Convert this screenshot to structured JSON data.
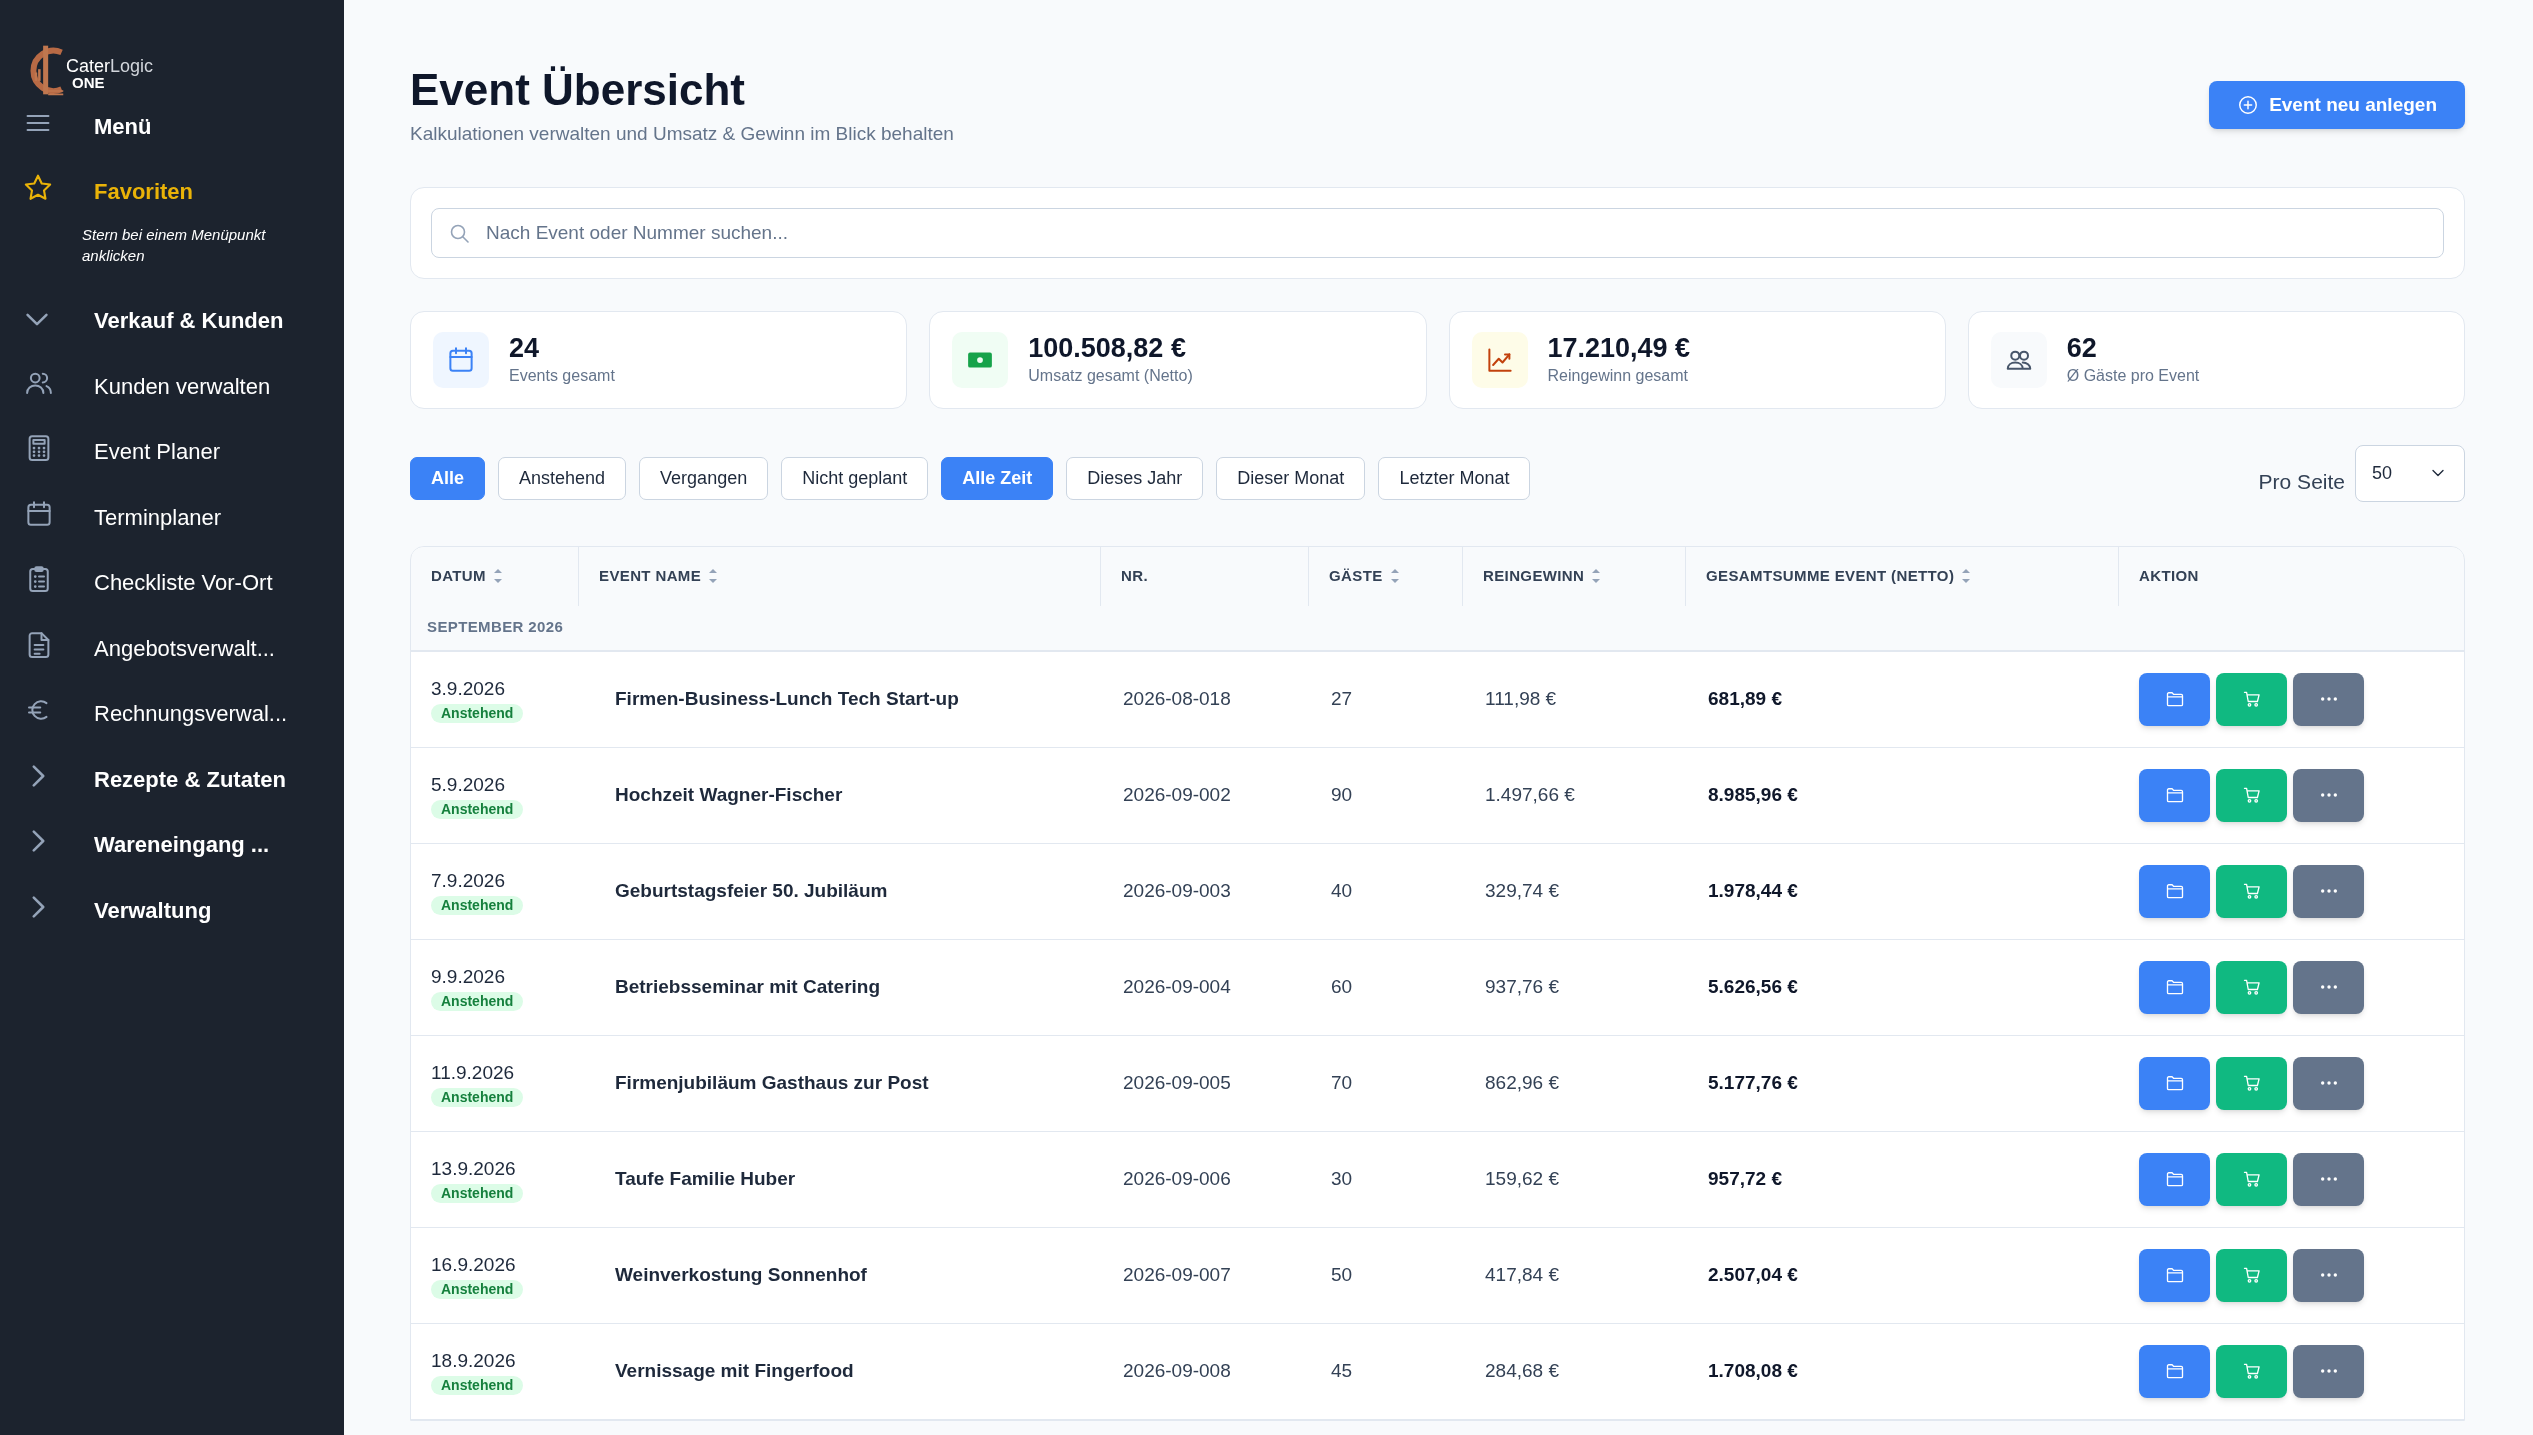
{
  "logo": {
    "part1": "Cater",
    "part2": "Logic",
    "sub": "ONE"
  },
  "sidebar": {
    "items": [
      {
        "kind": "menu",
        "label": "Menü"
      },
      {
        "kind": "favorites",
        "label": "Favoriten"
      },
      {
        "kind": "hint",
        "label": "Stern bei einem Menüpunkt anklicken"
      },
      {
        "kind": "group",
        "label": "Verkauf & Kunden",
        "expanded": true
      },
      {
        "kind": "link",
        "label": "Kunden verwalten"
      },
      {
        "kind": "link",
        "label": "Event Planer"
      },
      {
        "kind": "link",
        "label": "Terminplaner"
      },
      {
        "kind": "link",
        "label": "Checkliste Vor-Ort"
      },
      {
        "kind": "link",
        "label": "Angebotsverwalt..."
      },
      {
        "kind": "link",
        "label": "Rechnungsverwal..."
      },
      {
        "kind": "group",
        "label": "Rezepte & Zutaten",
        "expanded": false
      },
      {
        "kind": "group",
        "label": "Wareneingang ...",
        "expanded": false
      },
      {
        "kind": "group",
        "label": "Verwaltung",
        "expanded": false
      }
    ]
  },
  "header": {
    "title": "Event Übersicht",
    "subtitle": "Kalkulationen verwalten und Umsatz & Gewinn im Blick behalten",
    "new_button": "Event neu anlegen"
  },
  "search": {
    "placeholder": "Nach Event oder Nummer suchen..."
  },
  "stats": [
    {
      "kind": "calendar",
      "value": "24",
      "label": "Events gesamt"
    },
    {
      "kind": "money",
      "value": "100.508,82 €",
      "label": "Umsatz gesamt (Netto)"
    },
    {
      "kind": "chart",
      "value": "17.210,49 €",
      "label": "Reingewinn gesamt"
    },
    {
      "kind": "guests",
      "value": "62",
      "label": "Ø Gäste pro Event"
    }
  ],
  "status_filters": [
    {
      "label": "Alle",
      "selected": true
    },
    {
      "label": "Anstehend",
      "selected": false
    },
    {
      "label": "Vergangen",
      "selected": false
    },
    {
      "label": "Nicht geplant",
      "selected": false
    }
  ],
  "time_filters": [
    {
      "label": "Alle Zeit",
      "selected": true
    },
    {
      "label": "Dieses Jahr",
      "selected": false
    },
    {
      "label": "Dieser Monat",
      "selected": false
    },
    {
      "label": "Letzter Monat",
      "selected": false
    }
  ],
  "per_page": {
    "label": "Pro Seite",
    "value": "50"
  },
  "table": {
    "columns": [
      {
        "label": "DATUM",
        "sortable": true
      },
      {
        "label": "EVENT NAME",
        "sortable": true
      },
      {
        "label": "NR.",
        "sortable": false
      },
      {
        "label": "GÄSTE",
        "sortable": true
      },
      {
        "label": "REINGEWINN",
        "sortable": true
      },
      {
        "label": "GESAMTSUMME EVENT (NETTO)",
        "sortable": true
      },
      {
        "label": "AKTION",
        "sortable": false
      }
    ],
    "group": "SEPTEMBER 2026",
    "rows": [
      {
        "date": "3.9.2026",
        "status": "Anstehend",
        "name": "Firmen-Business-Lunch Tech Start-up",
        "nr": "2026-08-018",
        "guests": "27",
        "profit": "111,98 €",
        "total": "681,89 €"
      },
      {
        "date": "5.9.2026",
        "status": "Anstehend",
        "name": "Hochzeit Wagner-Fischer",
        "nr": "2026-09-002",
        "guests": "90",
        "profit": "1.497,66 €",
        "total": "8.985,96 €"
      },
      {
        "date": "7.9.2026",
        "status": "Anstehend",
        "name": "Geburtstagsfeier 50. Jubiläum",
        "nr": "2026-09-003",
        "guests": "40",
        "profit": "329,74 €",
        "total": "1.978,44 €"
      },
      {
        "date": "9.9.2026",
        "status": "Anstehend",
        "name": "Betriebsseminar mit Catering",
        "nr": "2026-09-004",
        "guests": "60",
        "profit": "937,76 €",
        "total": "5.626,56 €"
      },
      {
        "date": "11.9.2026",
        "status": "Anstehend",
        "name": "Firmenjubiläum Gasthaus zur Post",
        "nr": "2026-09-005",
        "guests": "70",
        "profit": "862,96 €",
        "total": "5.177,76 €"
      },
      {
        "date": "13.9.2026",
        "status": "Anstehend",
        "name": "Taufe Familie Huber",
        "nr": "2026-09-006",
        "guests": "30",
        "profit": "159,62 €",
        "total": "957,72 €"
      },
      {
        "date": "16.9.2026",
        "status": "Anstehend",
        "name": "Weinverkostung Sonnenhof",
        "nr": "2026-09-007",
        "guests": "50",
        "profit": "417,84 €",
        "total": "2.507,04 €"
      },
      {
        "date": "18.9.2026",
        "status": "Anstehend",
        "name": "Vernissage mit Fingerfood",
        "nr": "2026-09-008",
        "guests": "45",
        "profit": "284,68 €",
        "total": "1.708,08 €"
      }
    ]
  }
}
